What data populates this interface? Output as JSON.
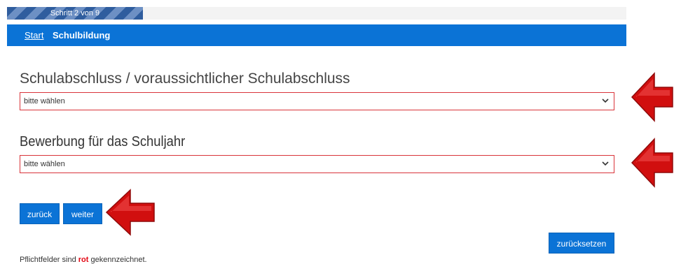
{
  "progress": {
    "label": "Schritt 2 von 9",
    "fraction": 0.22
  },
  "breadcrumb": {
    "start_label": "Start",
    "current_label": "Schulbildung"
  },
  "field_school_degree": {
    "label": "Schulabschluss / voraussichtlicher Schulabschluss",
    "value": "bitte wählen"
  },
  "field_school_year": {
    "label": "Bewerbung für das Schuljahr",
    "value": "bitte wählen"
  },
  "buttons": {
    "back_label": "zurück",
    "next_label": "weiter",
    "reset_label": "zurücksetzen"
  },
  "footer": {
    "text_before": "Pflichtfelder sind ",
    "highlight": "rot",
    "text_after": " gekennzeichnet."
  },
  "colors": {
    "accent": "#0b73d6",
    "required": "#d9343a",
    "arrow": "#d10f0f"
  },
  "icons": {
    "select_chevron": "chevron-down-icon",
    "annotation": "red-arrow-icon"
  }
}
